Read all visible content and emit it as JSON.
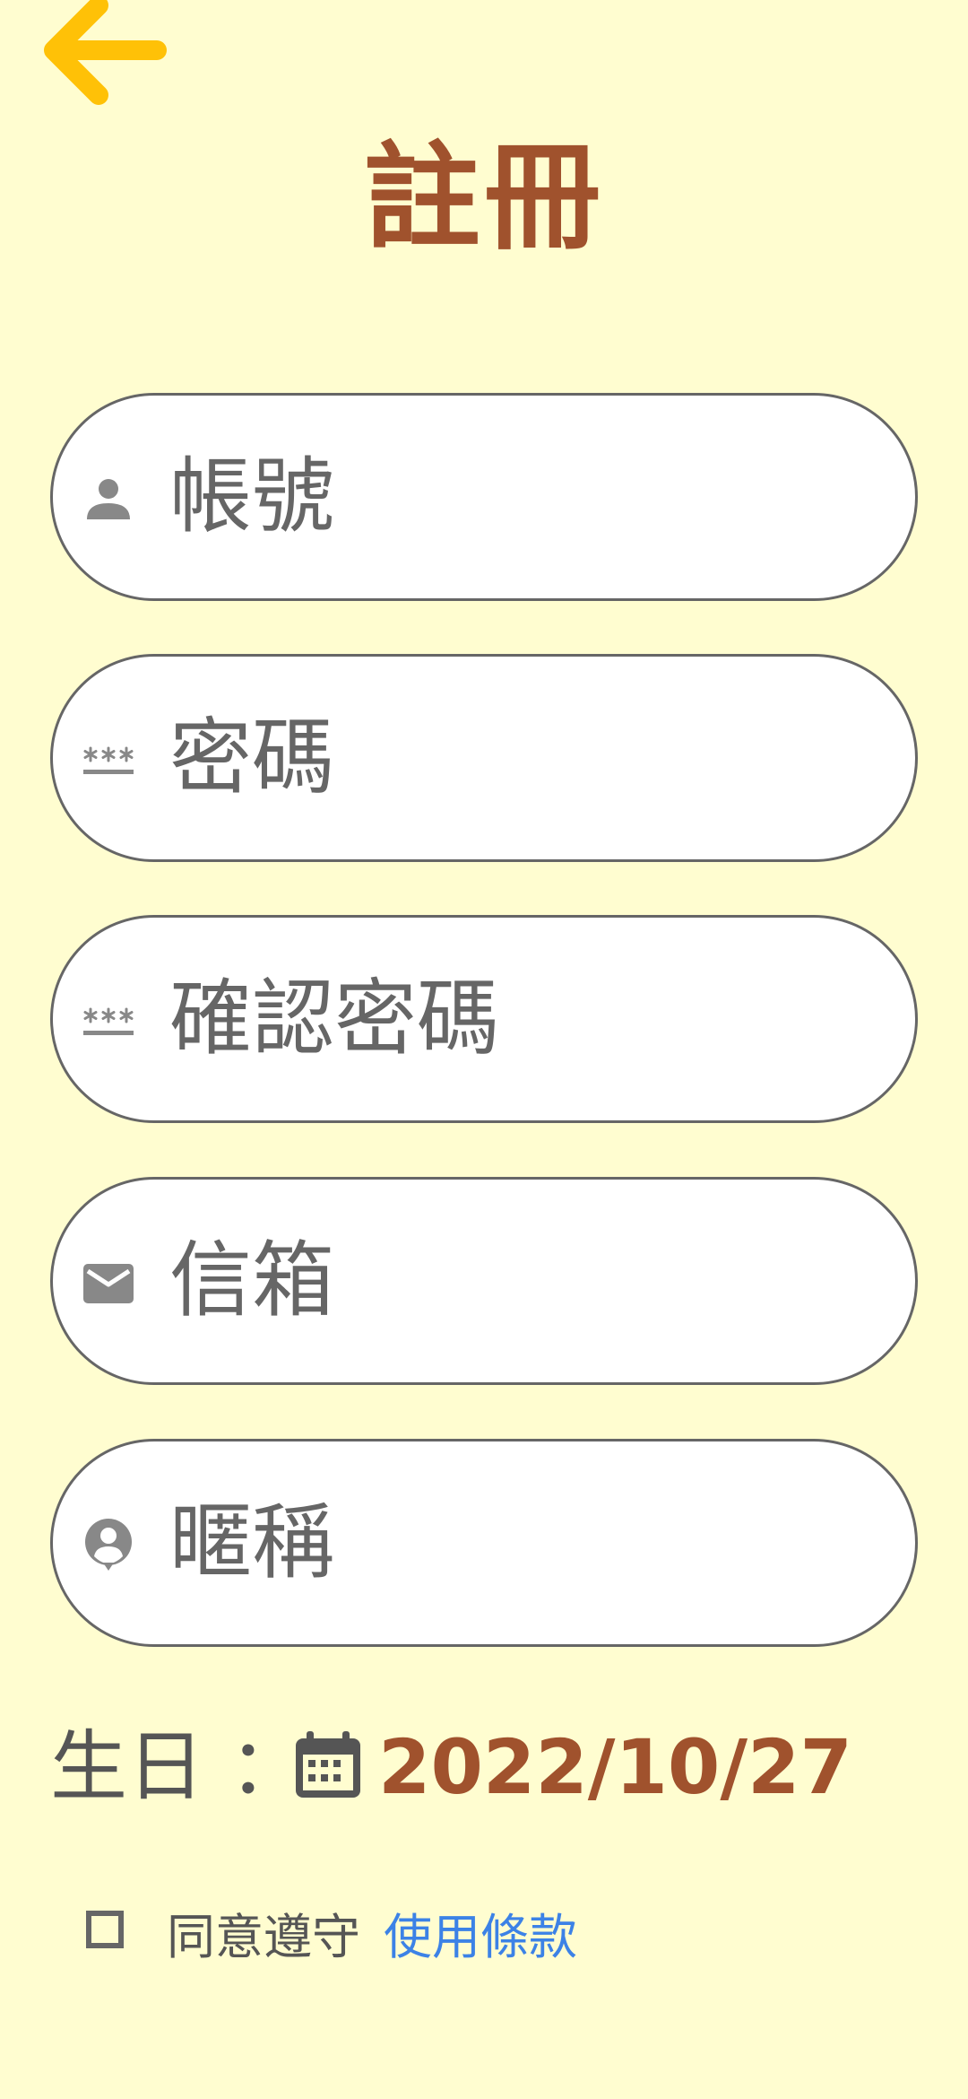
{
  "header": {
    "back_icon": "arrow-left-icon",
    "title": "註冊",
    "accent_color": "#FFC107",
    "title_color": "#A0522D"
  },
  "form": {
    "fields": [
      {
        "icon": "person-icon",
        "placeholder": "帳號"
      },
      {
        "icon": "password-icon",
        "placeholder": "密碼"
      },
      {
        "icon": "password-icon",
        "placeholder": "確認密碼"
      },
      {
        "icon": "mail-icon",
        "placeholder": "信箱"
      },
      {
        "icon": "account-circle-icon",
        "placeholder": "暱稱"
      }
    ]
  },
  "birthday": {
    "label": "生日 ：",
    "icon": "calendar-icon",
    "value": "2022/10/27"
  },
  "terms": {
    "checked": false,
    "text": "同意遵守",
    "link": "使用條款",
    "link_color": "#3C82E6"
  },
  "colors": {
    "background": "#FFFDD0",
    "field_border": "#666666",
    "placeholder": "#666666"
  }
}
